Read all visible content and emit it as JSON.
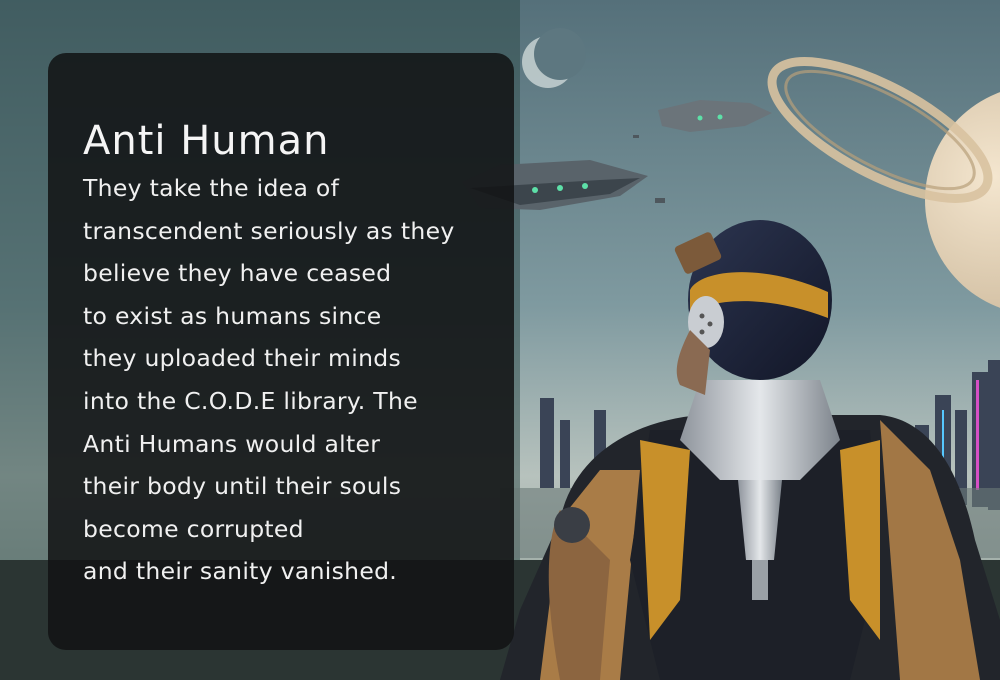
{
  "lore_card": {
    "title": "Anti Human",
    "body_lines": [
      "They take the idea of",
      "transcendent seriously as they",
      "believe they have ceased",
      "to exist as humans since",
      "they uploaded their minds",
      "into the C.O.D.E library. The",
      "Anti Humans would alter",
      "their body until their souls",
      "become corrupted",
      "and their sanity vanished."
    ]
  },
  "colors": {
    "panel_background": "#111314",
    "text": "#f2f2f2",
    "armor_gold": "#c8902a"
  }
}
